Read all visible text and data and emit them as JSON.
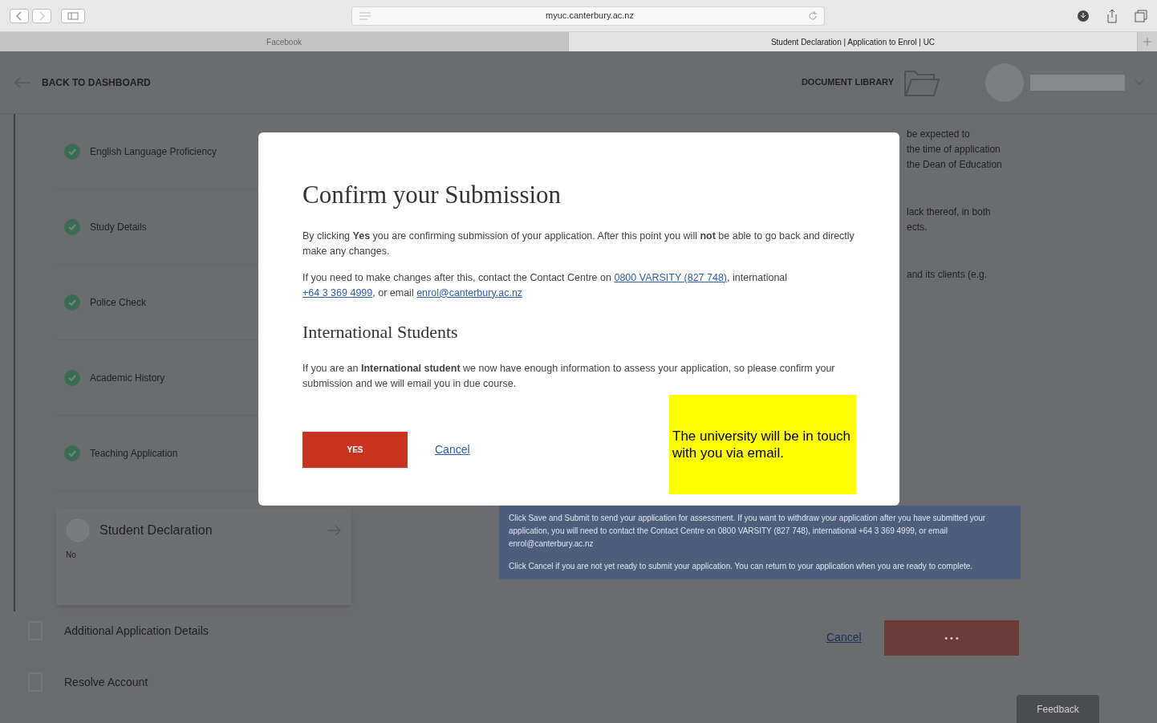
{
  "browser": {
    "url": "myuc.canterbury.ac.nz",
    "tabs": [
      {
        "label": "Facebook",
        "selected": false
      },
      {
        "label": "Student Declaration | Application to Enrol | UC",
        "selected": true
      }
    ]
  },
  "header": {
    "back": "BACK TO DASHBOARD",
    "library": "DOCUMENT LIBRARY"
  },
  "steps": [
    {
      "label": "English Language Proficiency",
      "completed": true
    },
    {
      "label": "Study Details",
      "completed": true
    },
    {
      "label": "Police Check",
      "completed": true
    },
    {
      "label": "Academic History",
      "completed": true
    },
    {
      "label": "Teaching Application",
      "completed": true
    },
    {
      "label": "Student Declaration",
      "completed": false,
      "status": "No"
    }
  ],
  "sections": [
    "Additional Application Details",
    "Resolve Account"
  ],
  "background_text": [
    "be expected to",
    "the time of application",
    "the Dean of Education",
    "lack thereof, in both",
    "ects.",
    "and its clients (e.g."
  ],
  "notice": [
    "Click Save and Submit to send your application for assessment. If you want to withdraw your application after you have submitted your application, you will need to contact the Contact Centre on 0800 VARSITY (827 748), international +64 3 369 4999, or email enrol@canterbury.ac.nz",
    "Click Cancel if you are not yet ready to submit your application. You can return to your application when you are ready to complete."
  ],
  "page_actions": {
    "cancel": "Cancel",
    "submit": "• • •"
  },
  "feedback": "Feedback",
  "modal": {
    "title": "Confirm your Submission",
    "intro": "By clicking **Yes** you are confirming submission of your application. After this point you will **not** be able to go back and directly make any changes.",
    "contact": {
      "before": "If you need to make changes after this, contact the Contact Centre on",
      "phone": "0800 VARSITY (827 748)",
      "middle": ", international",
      "intl": "+64 3 369 4999",
      "or": ", or email",
      "email": "enrol@canterbury.ac.nz"
    },
    "subtitle": "International Students",
    "intl_text": "If you are an **International student** we now have enough information to assess your application, so please confirm your submission and we will email you in due course.",
    "yes": "YES",
    "cancel": "Cancel"
  },
  "annotation": "The university will be in touch with you via email."
}
